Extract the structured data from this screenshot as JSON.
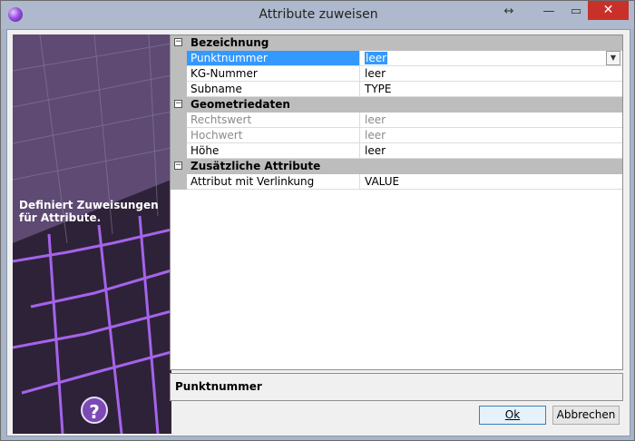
{
  "window": {
    "title": "Attribute zuweisen",
    "restore_glyph": "↔",
    "minimize_glyph": "—",
    "maximize_glyph": "▭",
    "close_glyph": "✕"
  },
  "side": {
    "description": "Definiert Zuweisungen für Attribute.",
    "help_glyph": "?"
  },
  "grid": {
    "categories": [
      {
        "label": "Bezeichnung",
        "rows": [
          {
            "name": "Punktnummer",
            "value": "leer",
            "selected": true
          },
          {
            "name": "KG-Nummer",
            "value": "leer"
          },
          {
            "name": "Subname",
            "value": "TYPE"
          }
        ]
      },
      {
        "label": "Geometriedaten",
        "rows": [
          {
            "name": "Rechtswert",
            "value": "leer",
            "disabled": true
          },
          {
            "name": "Hochwert",
            "value": "leer",
            "disabled": true
          },
          {
            "name": "Höhe",
            "value": "leer"
          }
        ]
      },
      {
        "label": "Zusätzliche Attribute",
        "rows": [
          {
            "name": "Attribut mit Verlinkung",
            "value": "VALUE"
          }
        ]
      }
    ],
    "expander_glyph": "−",
    "dropdown_glyph": "▼"
  },
  "description_panel": {
    "title": "Punktnummer"
  },
  "buttons": {
    "ok": "Ok",
    "cancel": "Abbrechen"
  }
}
